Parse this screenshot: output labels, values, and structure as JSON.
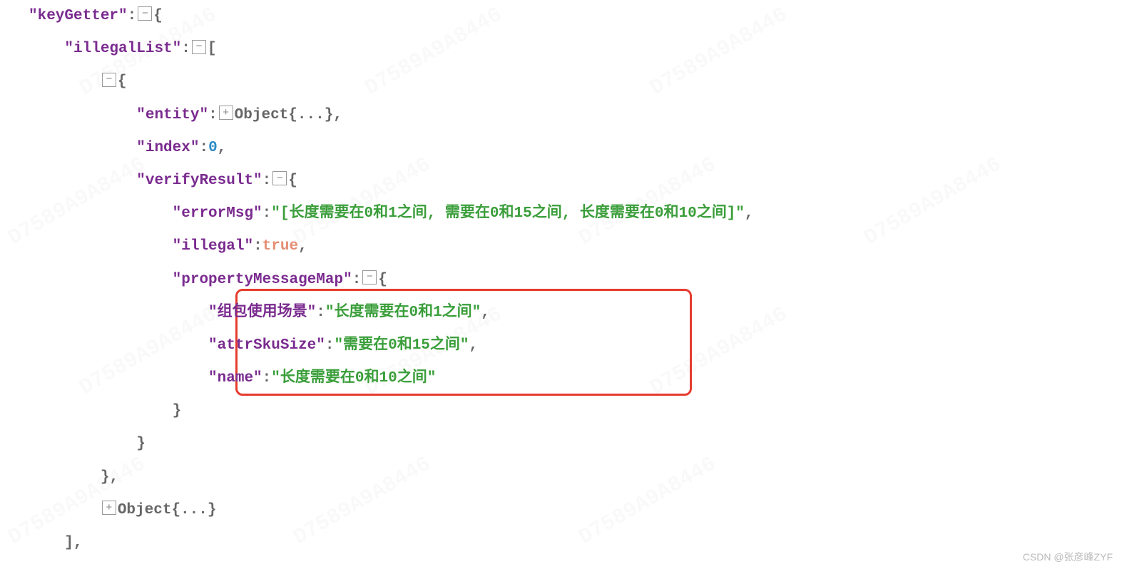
{
  "json": {
    "keys": {
      "keyGetter": "\"keyGetter\"",
      "illegalList": "\"illegalList\"",
      "entity": "\"entity\"",
      "index": "\"index\"",
      "verifyResult": "\"verifyResult\"",
      "errorMsg": "\"errorMsg\"",
      "illegal": "\"illegal\"",
      "propertyMessageMap": "\"propertyMessageMap\"",
      "pmm1_key": "\"组包使用场景\"",
      "pmm2_key": "\"attrSkuSize\"",
      "pmm3_key": "\"name\""
    },
    "values": {
      "entity_val": "Object{...}",
      "index_val": "0",
      "errorMsg_val": "\"[长度需要在0和1之间, 需要在0和15之间, 长度需要在0和10之间]\"",
      "illegal_val": "true",
      "pmm1_val": "\"长度需要在0和1之间\"",
      "pmm2_val": "\"需要在0和15之间\"",
      "pmm3_val": "\"长度需要在0和10之间\"",
      "collapsed_obj": "Object{...}"
    },
    "punct": {
      "colon": ":",
      "comma": ",",
      "open_brace": "{",
      "close_brace": "}",
      "open_bracket": "[",
      "close_bracket": "]"
    },
    "toggle": {
      "minus": "⊟",
      "plus": "⊞"
    }
  },
  "footer": "CSDN @张彦峰ZYF",
  "watermark": "D7589A9A8446"
}
